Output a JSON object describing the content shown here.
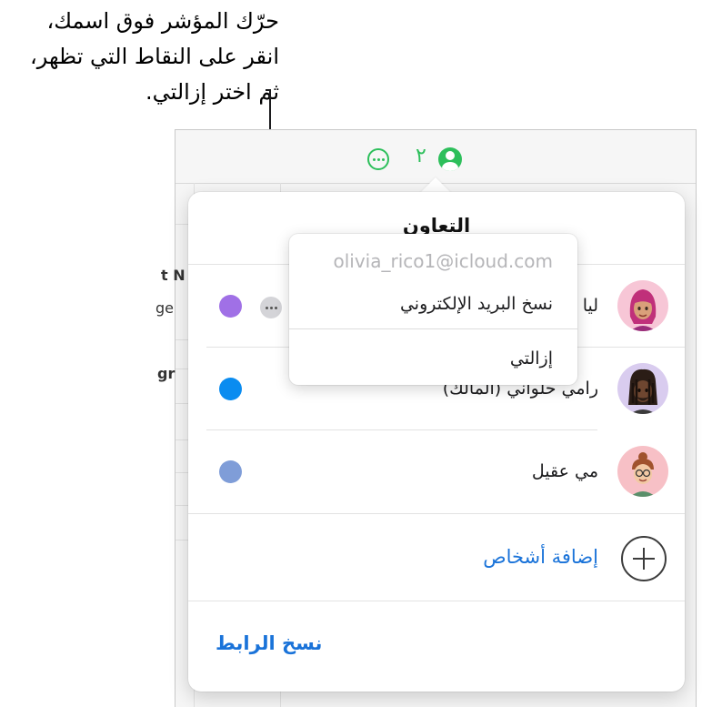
{
  "callout": {
    "line1": "حرّك المؤشر فوق اسمك،",
    "line2": "انقر على النقاط التي تظهر،",
    "line3": "ثم اختر إزالتي."
  },
  "toolbar": {
    "participant_count": "٢",
    "more_icon": "ellipsis-circle-icon",
    "collab_icon": "person-circle-icon",
    "accent_color": "#2dbf5b"
  },
  "sheet": {
    "fragments": [
      "t N",
      "ge",
      "gr"
    ]
  },
  "popover": {
    "title": "التعاون",
    "participants": [
      {
        "name": "ليا",
        "dot_color": "#a070e6",
        "avatar_bg": "#f7c6d6"
      },
      {
        "name": "رامي حلواني (المالك)",
        "dot_color": "#0a8cf0",
        "avatar_bg": "#d9ccef"
      },
      {
        "name": "مي عقيل",
        "dot_color": "#7f9dd8",
        "avatar_bg": "#f7c0c6"
      }
    ],
    "add_people": "إضافة أشخاص",
    "copy_link": "نسخ الرابط",
    "link_color": "#1a73d9"
  },
  "menu": {
    "email": "olivia_rico1@icloud.com",
    "copy_email": "نسخ البريد الإلكتروني",
    "remove_me": "إزالتي"
  }
}
